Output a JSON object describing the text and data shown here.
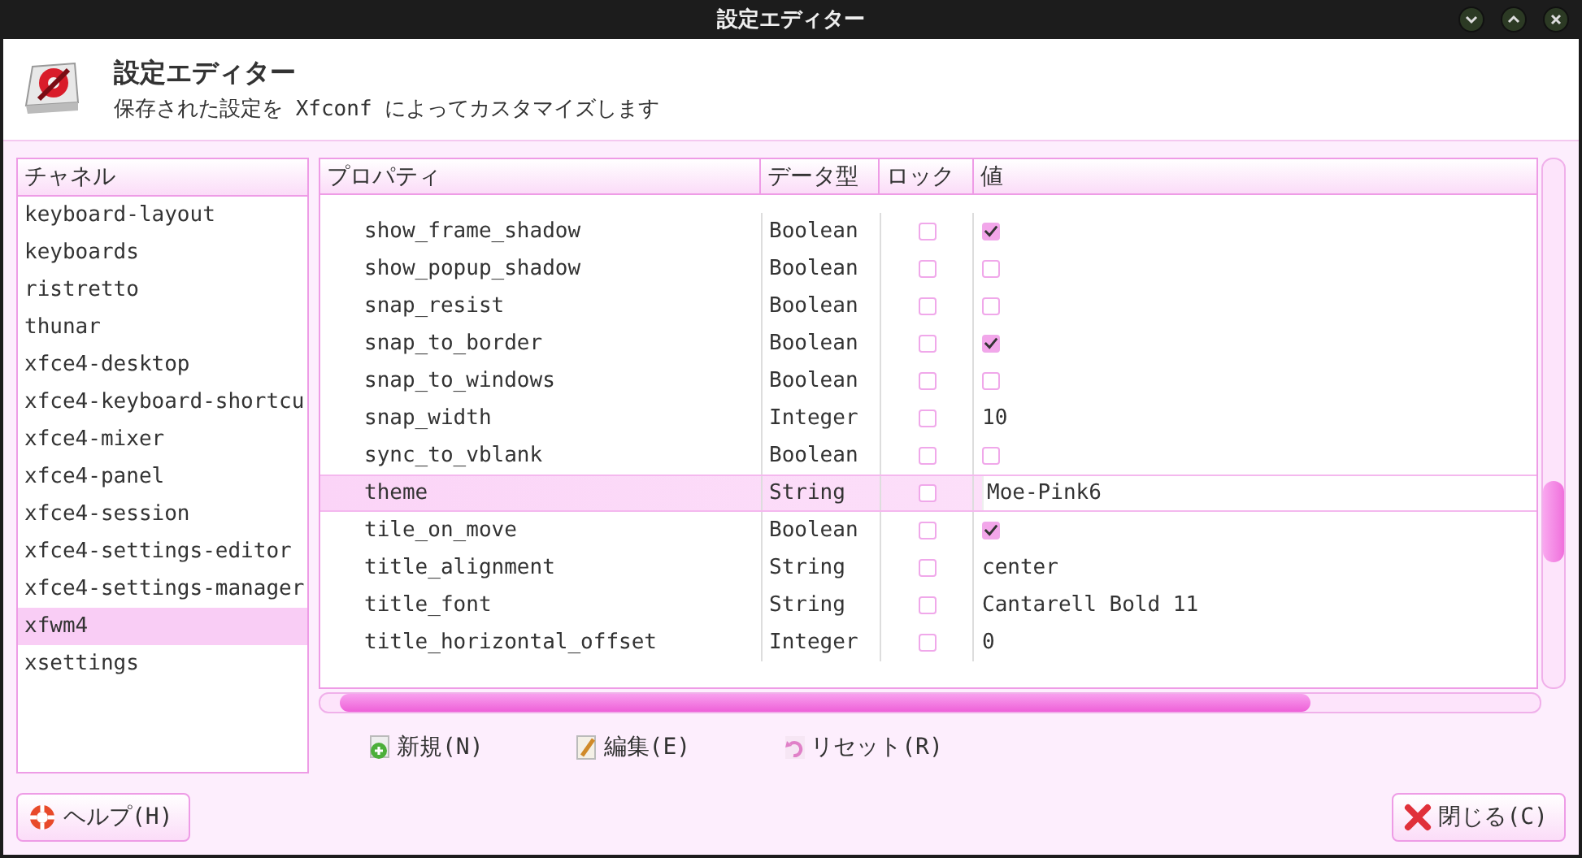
{
  "window": {
    "title": "設定エディター"
  },
  "header": {
    "title": "設定エディター",
    "subtitle": "保存された設定を Xfconf によってカスタマイズします"
  },
  "channels": {
    "heading": "チャネル",
    "items": [
      {
        "label": "keyboard-layout",
        "selected": false
      },
      {
        "label": "keyboards",
        "selected": false
      },
      {
        "label": "ristretto",
        "selected": false
      },
      {
        "label": "thunar",
        "selected": false
      },
      {
        "label": "xfce4-desktop",
        "selected": false
      },
      {
        "label": "xfce4-keyboard-shortcu",
        "selected": false
      },
      {
        "label": "xfce4-mixer",
        "selected": false
      },
      {
        "label": "xfce4-panel",
        "selected": false
      },
      {
        "label": "xfce4-session",
        "selected": false
      },
      {
        "label": "xfce4-settings-editor",
        "selected": false
      },
      {
        "label": "xfce4-settings-manager",
        "selected": false
      },
      {
        "label": "xfwm4",
        "selected": true
      },
      {
        "label": "xsettings",
        "selected": false
      }
    ]
  },
  "table": {
    "columns": [
      "プロパティ",
      "データ型",
      "ロック",
      "値"
    ],
    "rows": [
      {
        "property": "show_frame_shadow",
        "type": "Boolean",
        "locked": false,
        "kind": "check",
        "checked": true,
        "selected": false
      },
      {
        "property": "show_popup_shadow",
        "type": "Boolean",
        "locked": false,
        "kind": "check",
        "checked": false,
        "selected": false
      },
      {
        "property": "snap_resist",
        "type": "Boolean",
        "locked": false,
        "kind": "check",
        "checked": false,
        "selected": false
      },
      {
        "property": "snap_to_border",
        "type": "Boolean",
        "locked": false,
        "kind": "check",
        "checked": true,
        "selected": false
      },
      {
        "property": "snap_to_windows",
        "type": "Boolean",
        "locked": false,
        "kind": "check",
        "checked": false,
        "selected": false
      },
      {
        "property": "snap_width",
        "type": "Integer",
        "locked": false,
        "kind": "text",
        "value": "10",
        "selected": false
      },
      {
        "property": "sync_to_vblank",
        "type": "Boolean",
        "locked": false,
        "kind": "check",
        "checked": false,
        "selected": false
      },
      {
        "property": "theme",
        "type": "String",
        "locked": false,
        "kind": "edit",
        "value": "Moe-Pink6",
        "selected": true
      },
      {
        "property": "tile_on_move",
        "type": "Boolean",
        "locked": false,
        "kind": "check",
        "checked": true,
        "selected": false
      },
      {
        "property": "title_alignment",
        "type": "String",
        "locked": false,
        "kind": "text",
        "value": "center",
        "selected": false
      },
      {
        "property": "title_font",
        "type": "String",
        "locked": false,
        "kind": "text",
        "value": "Cantarell Bold 11",
        "selected": false
      },
      {
        "property": "title_horizontal_offset",
        "type": "Integer",
        "locked": false,
        "kind": "text",
        "value": "0",
        "selected": false
      }
    ]
  },
  "actions": [
    "新規(N)",
    "編集(E)",
    "リセット(R)"
  ],
  "buttons": {
    "help": "ヘルプ(H)",
    "close": "閉じる(C)"
  }
}
